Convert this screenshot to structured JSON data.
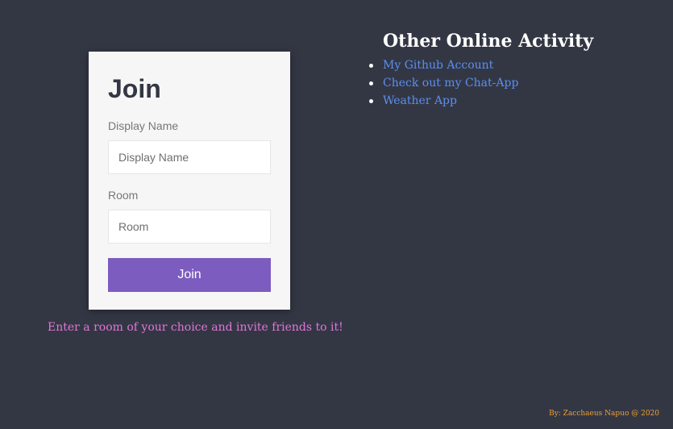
{
  "join": {
    "title": "Join",
    "display_name": {
      "label": "Display Name",
      "placeholder": "Display Name",
      "value": ""
    },
    "room": {
      "label": "Room",
      "placeholder": "Room",
      "value": ""
    },
    "button_label": "Join"
  },
  "tagline": "Enter a room of your choice and invite friends to it!",
  "activity": {
    "title": "Other Online Activity",
    "links": [
      {
        "label": "My Github Account"
      },
      {
        "label": "Check out my Chat-App"
      },
      {
        "label": "Weather App"
      }
    ]
  },
  "footer": {
    "credit": "By: Zacchaeus Napuo @ 2020"
  },
  "colors": {
    "background": "#333744",
    "card": "#f6f6f7",
    "button": "#7c5cbf",
    "link": "#5b8ff0",
    "tagline": "#e076d8",
    "credit": "#f0a030"
  }
}
